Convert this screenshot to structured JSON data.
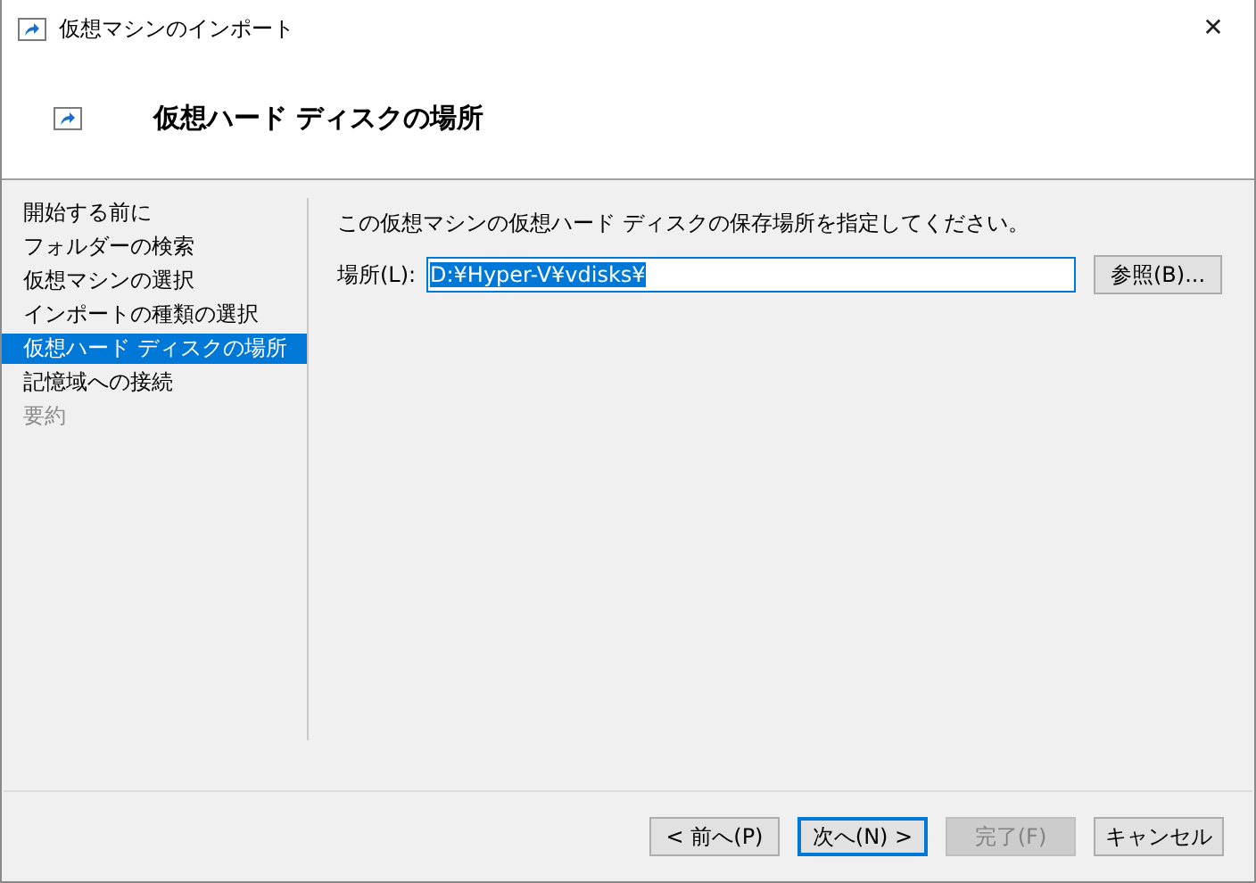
{
  "window": {
    "title": "仮想マシンのインポート",
    "close": "✕"
  },
  "header": {
    "title": "仮想ハード ディスクの場所"
  },
  "steps": [
    {
      "label": "開始する前に",
      "selected": false,
      "disabled": false
    },
    {
      "label": "フォルダーの検索",
      "selected": false,
      "disabled": false
    },
    {
      "label": "仮想マシンの選択",
      "selected": false,
      "disabled": false
    },
    {
      "label": "インポートの種類の選択",
      "selected": false,
      "disabled": false
    },
    {
      "label": "仮想ハード ディスクの場所",
      "selected": true,
      "disabled": false
    },
    {
      "label": "記憶域への接続",
      "selected": false,
      "disabled": false
    },
    {
      "label": "要約",
      "selected": false,
      "disabled": true
    }
  ],
  "content": {
    "instruction": "この仮想マシンの仮想ハード ディスクの保存場所を指定してください。",
    "location_label": "場所(L):",
    "location_value": "D:¥Hyper-V¥vdisks¥",
    "value_selected": true,
    "browse_button": "参照(B)..."
  },
  "buttons": [
    {
      "label": "< 前へ(P)",
      "default": false,
      "disabled": false
    },
    {
      "label": "次へ(N) >",
      "default": true,
      "disabled": false
    },
    {
      "label": "完了(F)",
      "default": false,
      "disabled": true
    },
    {
      "label": "キャンセル",
      "default": false,
      "disabled": false
    }
  ]
}
